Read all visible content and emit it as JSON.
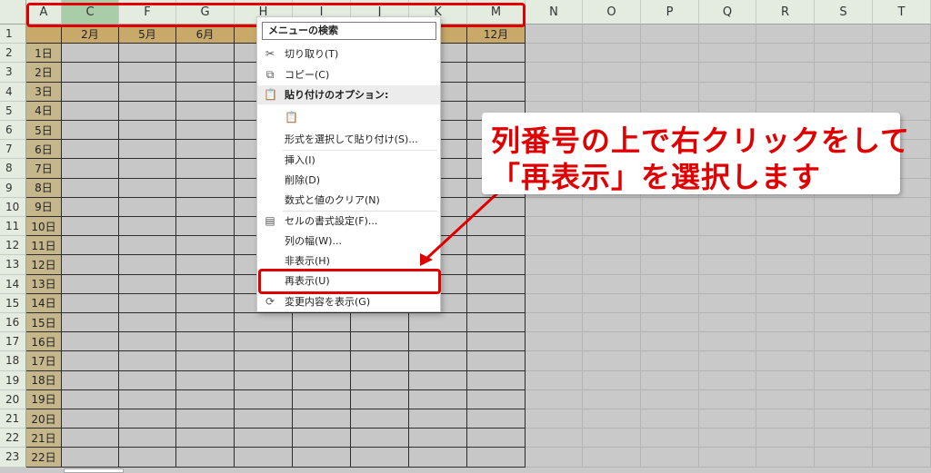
{
  "colors": {
    "header_bg": "#e3ecdf",
    "selected_header_bg": "#a9cca9",
    "month_header_bg": "#c8a96a",
    "day_bg": "#c5b68b",
    "grid_fill": "#c7c7c7",
    "highlight_red": "#e00000"
  },
  "column_headers": [
    "A",
    "C",
    "F",
    "G",
    "H",
    "I",
    "J",
    "K",
    "M",
    "N",
    "O",
    "P",
    "Q",
    "R",
    "S",
    "T"
  ],
  "row_numbers": [
    "1",
    "2",
    "3",
    "4",
    "5",
    "6",
    "7",
    "8",
    "9",
    "10",
    "11",
    "12",
    "13",
    "14",
    "15",
    "16",
    "17",
    "18",
    "19",
    "20",
    "21",
    "22",
    "23"
  ],
  "month_headers": [
    "2月",
    "5月",
    "6月",
    "",
    "",
    "",
    "",
    "12月"
  ],
  "days": [
    "1日",
    "2日",
    "3日",
    "4日",
    "5日",
    "6日",
    "7日",
    "8日",
    "9日",
    "10日",
    "11日",
    "12日",
    "13日",
    "14日",
    "15日",
    "16日",
    "17日",
    "18日",
    "19日",
    "20日",
    "21日",
    "22日"
  ],
  "context_menu": {
    "search_placeholder": "メニューの検索",
    "cut": "切り取り(T)",
    "copy": "コピー(C)",
    "paste_options": "貼り付けのオプション:",
    "paste_special": "形式を選択して貼り付け(S)...",
    "insert": "挿入(I)",
    "delete": "削除(D)",
    "clear_contents": "数式と値のクリア(N)",
    "format_cells": "セルの書式設定(F)...",
    "column_width": "列の幅(W)...",
    "hide": "非表示(H)",
    "unhide": "再表示(U)",
    "show_changes": "変更内容を表示(G)"
  },
  "callout": {
    "line1": "列番号の上で右クリックをして",
    "line2": "「再表示」を選択します"
  }
}
